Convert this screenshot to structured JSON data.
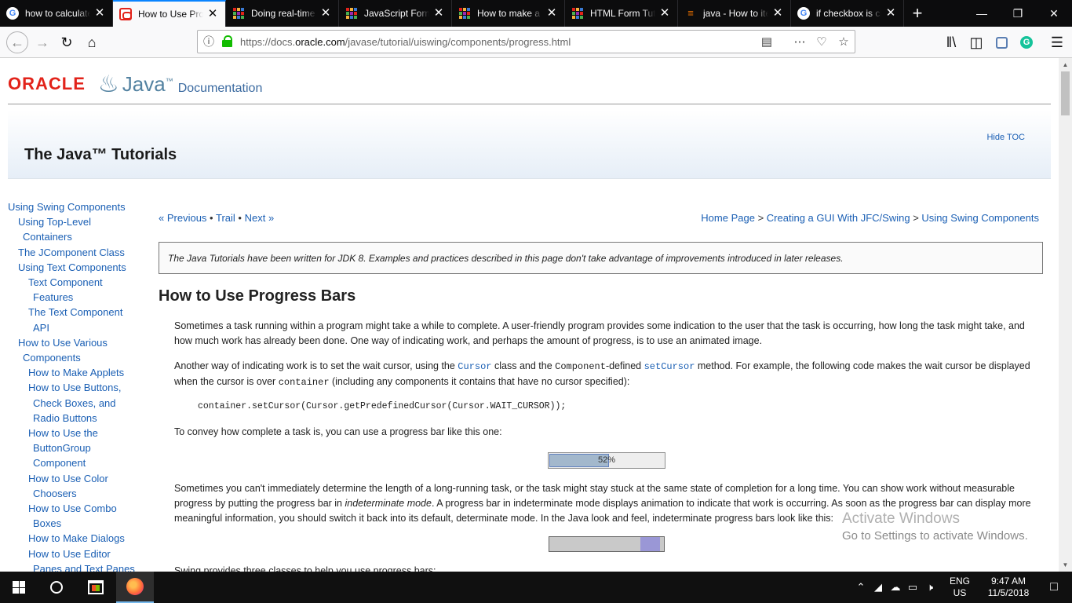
{
  "browser": {
    "tabs": [
      {
        "title": "how to calculate t",
        "favicon": "google-icon"
      },
      {
        "title": "How to Use Prog",
        "favicon": "oracle-icon",
        "active": true
      },
      {
        "title": "Doing real-time c",
        "favicon": "grid-icon"
      },
      {
        "title": "JavaScript Form V",
        "favicon": "grid-icon"
      },
      {
        "title": "How to make a w",
        "favicon": "grid-icon"
      },
      {
        "title": "HTML Form Tutor",
        "favicon": "grid-icon"
      },
      {
        "title": "java - How to iter",
        "favicon": "stackoverflow-icon"
      },
      {
        "title": "if checkbox is che",
        "favicon": "google-icon"
      }
    ],
    "new_tab": "+",
    "url_prefix": "https://docs.",
    "url_domain": "oracle.com",
    "url_path": "/javase/tutorial/uiswing/components/progress.html"
  },
  "page": {
    "oracle_logo": "ORACLE",
    "java_word": "Java",
    "java_tm": "™",
    "doc_word": "Documentation",
    "tutorial_title": "The Java™ Tutorials",
    "hide_toc": "Hide TOC",
    "toc": [
      {
        "label": "Using Swing Components",
        "level": 1
      },
      {
        "label": "Using Top-Level Containers",
        "level": 2
      },
      {
        "label": "The JComponent Class",
        "level": 2
      },
      {
        "label": "Using Text Components",
        "level": 2
      },
      {
        "label": "Text Component Features",
        "level": 3
      },
      {
        "label": "The Text Component API",
        "level": 3
      },
      {
        "label": "How to Use Various Components",
        "level": 2
      },
      {
        "label": "How to Make Applets",
        "level": 3
      },
      {
        "label": "How to Use Buttons, Check Boxes, and Radio Buttons",
        "level": 3
      },
      {
        "label": "How to Use the ButtonGroup Component",
        "level": 3
      },
      {
        "label": "How to Use Color Choosers",
        "level": 3
      },
      {
        "label": "How to Use Combo Boxes",
        "level": 3
      },
      {
        "label": "How to Make Dialogs",
        "level": 3
      },
      {
        "label": "How to Use Editor Panes and Text Panes",
        "level": 3
      }
    ],
    "nav_previous": "« Previous",
    "nav_trail": "Trail",
    "nav_next": "Next »",
    "nav_sep": "•",
    "crumb_home": "Home Page",
    "crumb_gui": "Creating a GUI With JFC/Swing",
    "crumb_swing": "Using Swing Components",
    "crumb_sep": ">",
    "note": "The Java Tutorials have been written for JDK 8. Examples and practices described in this page don't take advantage of improvements introduced in later releases.",
    "heading": "How to Use Progress Bars",
    "para1": "Sometimes a task running within a program might take a while to complete. A user-friendly program provides some indication to the user that the task is occurring, how long the task might take, and how much work has already been done. One way of indicating work, and perhaps the amount of progress, is to use an animated image.",
    "para2_a": "Another way of indicating work is to set the wait cursor, using the ",
    "para2_cursor": "Cursor",
    "para2_b": " class and the ",
    "para2_component": "Component",
    "para2_c": "-defined ",
    "para2_setcursor": "setCursor",
    "para2_d": " method. For example, the following code makes the wait cursor be displayed when the cursor is over ",
    "para2_container": "container",
    "para2_e": " (including any components it contains that have no cursor specified):",
    "code_line": "container.setCursor(Cursor.getPredefinedCursor(Cursor.WAIT_CURSOR));",
    "para3": "To convey how complete a task is, you can use a progress bar like this one:",
    "progress_value": 0.52,
    "progress_label": "52%",
    "para4_a": "Sometimes you can't immediately determine the length of a long-running task, or the task might stay stuck at the same state of completion for a long time. You can show work without measurable progress by putting the progress bar in ",
    "para4_em": "indeterminate mode",
    "para4_b": ". A progress bar in indeterminate mode displays animation to indicate that work is occurring. As soon as the progress bar can display more meaningful information, you should switch it back into its default, determinate mode. In the Java look and feel, indeterminate progress bars look like this:",
    "para5": "Swing provides three classes to help you use progress bars:"
  },
  "watermark": {
    "line1": "Activate Windows",
    "line2": "Go to Settings to activate Windows."
  },
  "taskbar": {
    "lang_line1": "ENG",
    "lang_line2": "US",
    "time": "9:47 AM",
    "date": "11/5/2018"
  },
  "colors": {
    "oracle_red": "#e2231a",
    "link_blue": "#1a5fb4",
    "progress_fill": "#a3b8cc",
    "indeterminate_chunk": "#9a97d6"
  }
}
